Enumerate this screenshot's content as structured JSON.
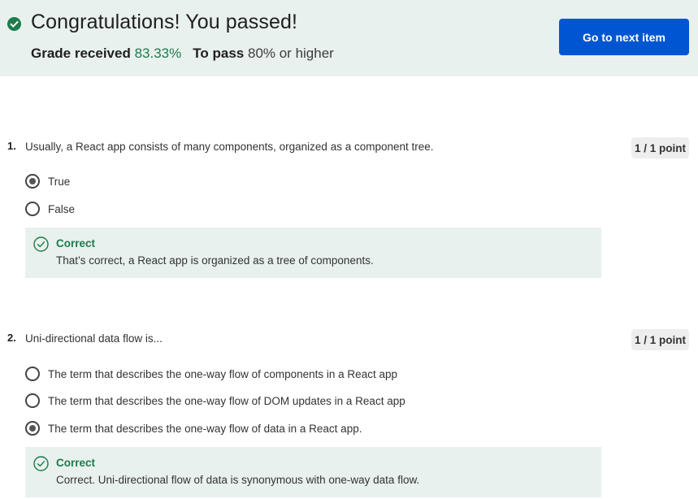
{
  "banner": {
    "title": "Congratulations! You passed!",
    "grade_label": "Grade received",
    "grade_value": "83.33%",
    "pass_label": "To pass",
    "pass_value": "80% or higher",
    "next_button": "Go to next item",
    "check_icon": "check-circle-icon"
  },
  "questions": [
    {
      "number": "1.",
      "text": "Usually, a React app consists of many components, organized as a component tree.",
      "points": "1 / 1 point",
      "options": [
        {
          "label": "True",
          "selected": true
        },
        {
          "label": "False",
          "selected": false
        }
      ],
      "feedback": {
        "title": "Correct",
        "text": "That’s correct, a React app is organized as a tree of components."
      }
    },
    {
      "number": "2.",
      "text": "Uni-directional data flow is...",
      "points": "1 / 1 point",
      "options": [
        {
          "label": "The term that describes the one-way flow of components in a React app",
          "selected": false
        },
        {
          "label": "The term that describes the one-way flow of DOM updates in a React app",
          "selected": false
        },
        {
          "label": "The term that describes the one-way flow of data in a React app.",
          "selected": true
        }
      ],
      "feedback": {
        "title": "Correct",
        "text": "Correct. Uni-directional flow of data is synonymous with one-way data flow."
      }
    }
  ],
  "colors": {
    "success": "#1e7b4b",
    "banner_bg": "#e8f1ee",
    "primary": "#0056d2"
  }
}
